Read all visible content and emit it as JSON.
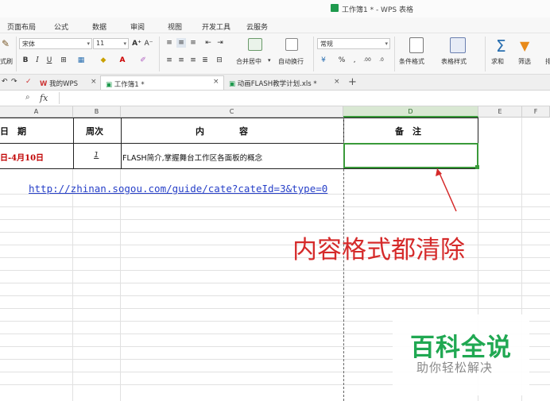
{
  "window": {
    "title": "工作簿1 * - WPS 表格"
  },
  "menu": {
    "items": [
      "页面布局",
      "公式",
      "数据",
      "审阅",
      "视图",
      "开发工具",
      "云服务"
    ]
  },
  "ribbon": {
    "font_name": "宋体",
    "font_size": "11",
    "format_value": "常规",
    "clipboard_label": "式刷",
    "merge_label": "合并居中",
    "wrap_label": "自动换行",
    "cond_format_label": "条件格式",
    "table_style_label": "表格样式",
    "sum_label": "求和",
    "filter_label": "筛选",
    "sort_label": "排",
    "bold": "B",
    "italic": "I",
    "underline": "U",
    "percent": "%",
    "comma": "‚",
    "inc_dec": ".00",
    "dec_dec": ".0"
  },
  "tabs": [
    {
      "label": "我的WPS"
    },
    {
      "label": "工作簿1 *"
    },
    {
      "label": "动画FLASH教学计划.xls *"
    }
  ],
  "formula_bar": {
    "fx": "fx"
  },
  "columns": [
    "A",
    "B",
    "C",
    "D",
    "E",
    "F"
  ],
  "table": {
    "headers": {
      "date": "日　期",
      "week": "周次",
      "content": "内　　　　容",
      "remark": "备　注"
    },
    "row1": {
      "date": "日-4月10日",
      "week": "1",
      "content": "FLASH简介,掌握舞台工作区各面板的概念",
      "remark": ""
    }
  },
  "link_text": "http://zhinan.sogou.com/guide/cate?cateId=3&type=0",
  "annotation": "内容格式都清除",
  "watermark": {
    "main": "百科全说",
    "sub": "助你轻松解决"
  },
  "colors": {
    "accent": "#3a9a3a",
    "annotation": "#d52a2a",
    "link": "#2740c8",
    "date_red": "#c00000"
  }
}
